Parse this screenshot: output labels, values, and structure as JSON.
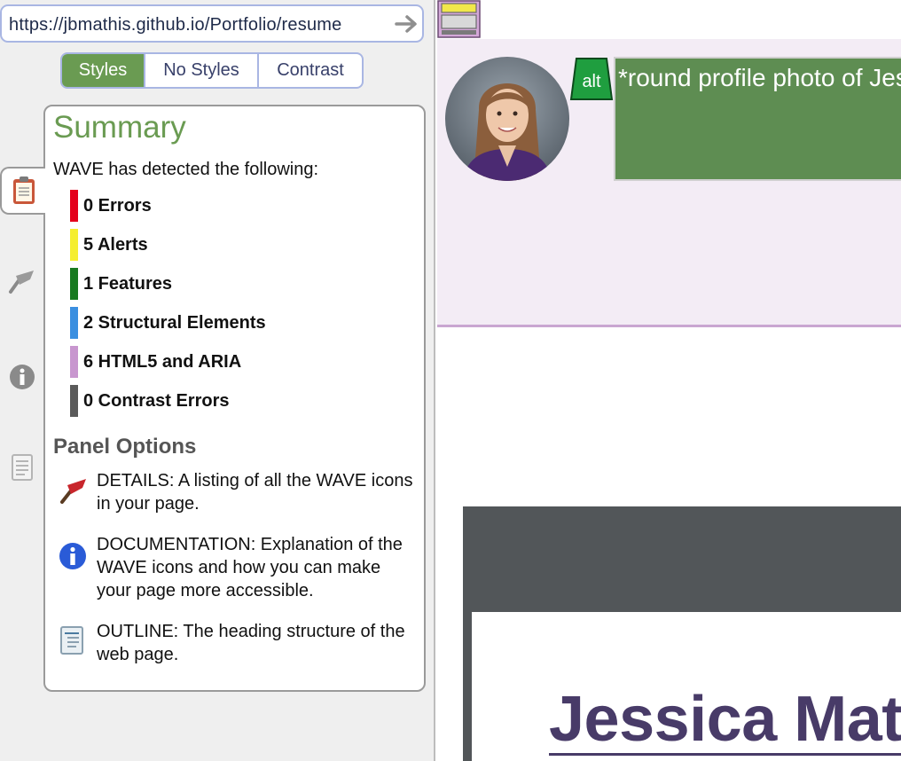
{
  "wave": {
    "url": "https://jbmathis.github.io/Portfolio/resume",
    "style_buttons": [
      {
        "label": "Styles",
        "active": true
      },
      {
        "label": "No Styles",
        "active": false
      },
      {
        "label": "Contrast",
        "active": false
      }
    ],
    "summary": {
      "title": "Summary",
      "intro": "WAVE has detected the following:",
      "stats": [
        {
          "label": "0 Errors",
          "color": "#e4001b"
        },
        {
          "label": "5 Alerts",
          "color": "#f5ee30"
        },
        {
          "label": "1 Features",
          "color": "#187a20"
        },
        {
          "label": "2 Structural Elements",
          "color": "#3b8fe0"
        },
        {
          "label": "6 HTML5 and ARIA",
          "color": "#c896cf"
        },
        {
          "label": "0 Contrast Errors",
          "color": "#5a5a5a"
        }
      ],
      "panel_options_title": "Panel Options",
      "options": [
        {
          "text": "DETAILS: A listing of all the WAVE icons in your page.",
          "icon": "flag-icon"
        },
        {
          "text": "DOCUMENTATION: Explanation of the WAVE icons and how you can make your page more accessible.",
          "icon": "info-icon"
        },
        {
          "text": "OUTLINE: The heading structure of the web page.",
          "icon": "outline-document-icon"
        }
      ]
    },
    "side_tabs": [
      "clipboard-icon",
      "flag-icon",
      "info-icon",
      "document-icon"
    ]
  },
  "page": {
    "alt_badge": "alt",
    "alt_text": "*round profile photo of Jessica",
    "name_heading": "Jessica Mathis",
    "colors": {
      "header_band": "#f3ecf5",
      "alt_box": "#5e8d52",
      "name": "#483b68",
      "dark_section": "#525659"
    }
  }
}
